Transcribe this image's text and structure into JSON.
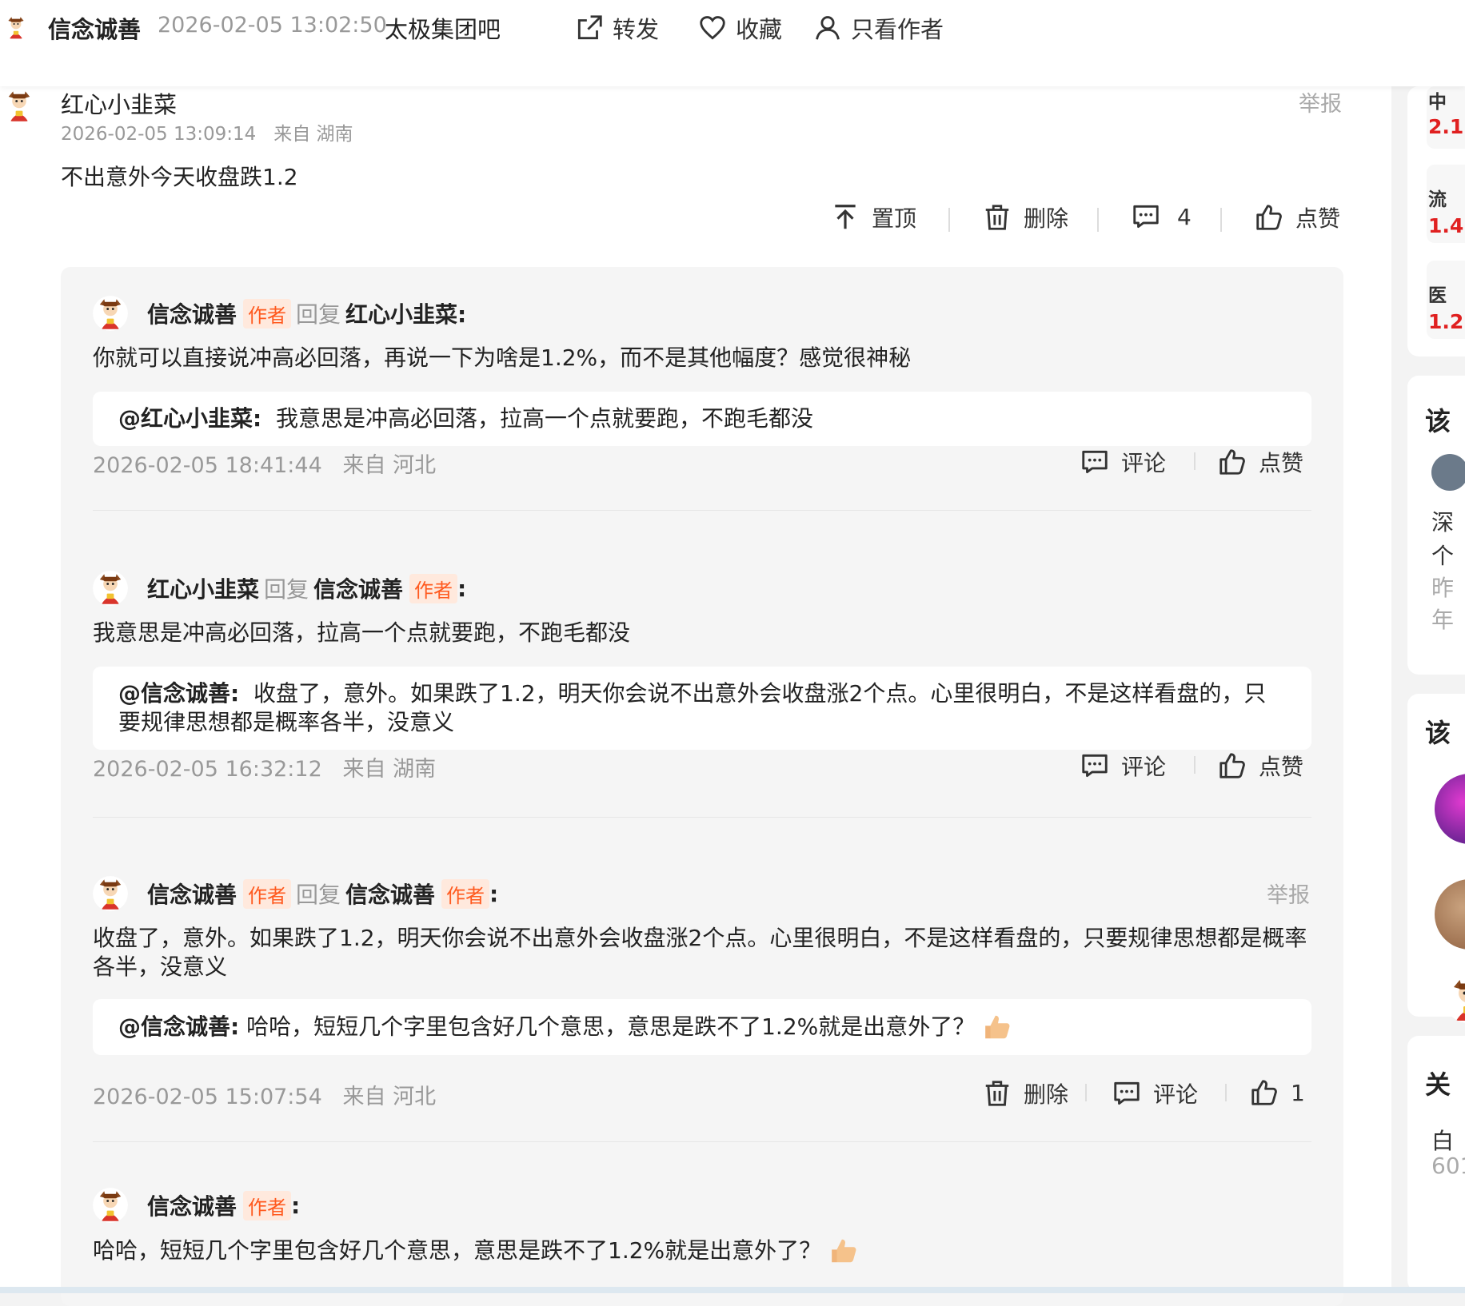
{
  "header": {
    "title": "信念诚善",
    "time": "2026-02-05 13:02:50",
    "bar_name": "太极集团吧",
    "share": "转发",
    "favorite": "收藏",
    "author_only": "只看作者"
  },
  "post": {
    "user": "红心小韭菜",
    "time": "2026-02-05 13:09:14",
    "location": "来自 湖南",
    "report": "举报",
    "content": "不出意外今天收盘跌1.2",
    "actions": {
      "pin": "置顶",
      "delete": "删除",
      "comment_count": "4",
      "like": "点赞"
    }
  },
  "replies": [
    {
      "user": "信念诚善",
      "author_tag": "作者",
      "reply_word": "回复",
      "target": "红心小韭菜:",
      "text": "你就可以直接说冲高必回落，再说一下为啥是1.2%，而不是其他幅度？感觉很神秘",
      "quote_user": "@红心小韭菜:",
      "quote_text": "我意思是冲高必回落，拉高一个点就要跑，不跑毛都没",
      "time": "2026-02-05 18:41:44",
      "location": "来自 河北",
      "comment": "评论",
      "like": "点赞"
    },
    {
      "user": "红心小韭菜",
      "reply_word": "回复",
      "target": "信念诚善",
      "target_tag": "作者",
      "colon": ":",
      "text": "我意思是冲高必回落，拉高一个点就要跑，不跑毛都没",
      "quote_user": "@信念诚善:",
      "quote_text": "收盘了，意外。如果跌了1.2，明天你会说不出意外会收盘涨2个点。心里很明白，不是这样看盘的，只要规律思想都是概率各半，没意义",
      "time": "2026-02-05 16:32:12",
      "location": "来自 湖南",
      "comment": "评论",
      "like": "点赞"
    },
    {
      "user": "信念诚善",
      "author_tag": "作者",
      "reply_word": "回复",
      "target": "信念诚善",
      "target_tag": "作者",
      "colon": ":",
      "report": "举报",
      "text": "收盘了，意外。如果跌了1.2，明天你会说不出意外会收盘涨2个点。心里很明白，不是这样看盘的，只要规律思想都是概率各半，没意义",
      "quote_user": "@信念诚善:",
      "quote_text": "哈哈，短短几个字里包含好几个意思，意思是跌不了1.2%就是出意外了？",
      "time": "2026-02-05 15:07:54",
      "location": "来自 河北",
      "delete": "删除",
      "comment": "评论",
      "like_count": "1"
    },
    {
      "user": "信念诚善",
      "author_tag": "作者",
      "colon": ":",
      "text": "哈哈，短短几个字里包含好几个意思，意思是跌不了1.2%就是出意外了？"
    }
  ],
  "sidebar": {
    "stocks": [
      {
        "name": "中",
        "value": "2.1"
      },
      {
        "name": "流",
        "value": "1.4"
      },
      {
        "name": "医",
        "value": "1.2"
      }
    ],
    "section1_title": "该",
    "section1_text1": "深",
    "section1_text2": "个",
    "section1_gray1": "昨",
    "section1_gray2": "年",
    "section2_title": "该",
    "section3_title": "关",
    "section3_text": "白",
    "section3_code": "601"
  },
  "colors": {
    "accent": "#ff5a1f",
    "red": "#e02020",
    "thumb": "#f5c28b"
  }
}
